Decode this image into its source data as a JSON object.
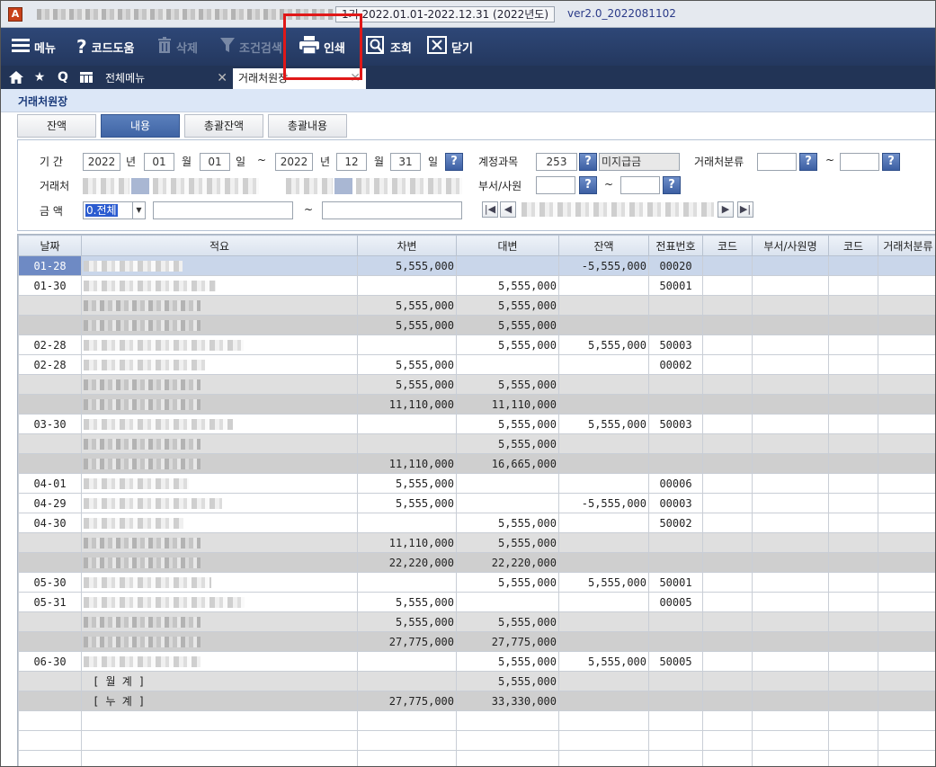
{
  "title_bar": {
    "period": "1기 2022.01.01-2022.12.31 (2022년도)",
    "version": "ver2.0_2022081102"
  },
  "toolbar": {
    "menu": "메뉴",
    "code_help": "코드도움",
    "delete": "삭제",
    "condition_search": "조건검색",
    "print": "인쇄",
    "query": "조회",
    "close": "닫기"
  },
  "tabs": {
    "all_menu": "전체메뉴",
    "ledger": "거래처원장"
  },
  "screen_title": "거래처원장",
  "view_tabs": [
    "잔액",
    "내용",
    "총괄잔액",
    "총괄내용"
  ],
  "filters": {
    "period_label": "기 간",
    "from_year": "2022",
    "from_month": "01",
    "from_day": "01",
    "to_year": "2022",
    "to_month": "12",
    "to_day": "31",
    "year_unit": "년",
    "month_unit": "월",
    "day_unit": "일",
    "tilde": "~",
    "account_label": "계정과목",
    "account_code": "253",
    "account_name": "미지급금",
    "partner_type_label": "거래처분류",
    "partner_label": "거래처",
    "dept_label": "부서/사원",
    "amount_label": "금 액",
    "amount_value": "0.전체",
    "help": "?"
  },
  "grid": {
    "columns": [
      "날짜",
      "적요",
      "차변",
      "대변",
      "잔액",
      "전표번호",
      "코드",
      "부서/사원명",
      "코드",
      "거래처분류"
    ],
    "rows": [
      {
        "date": "01-28",
        "memo": "",
        "debit": "5,555,000",
        "credit": "",
        "balance": "-5,555,000",
        "voucher": "00020",
        "tone": "sel"
      },
      {
        "date": "01-30",
        "memo": "",
        "debit": "",
        "credit": "5,555,000",
        "balance": "",
        "voucher": "50001",
        "tone": "t1"
      },
      {
        "date": "",
        "memo": "",
        "debit": "5,555,000",
        "credit": "5,555,000",
        "balance": "",
        "voucher": "",
        "tone": "t2"
      },
      {
        "date": "",
        "memo": "",
        "debit": "5,555,000",
        "credit": "5,555,000",
        "balance": "",
        "voucher": "",
        "tone": "t3"
      },
      {
        "date": "02-28",
        "memo": "",
        "debit": "",
        "credit": "5,555,000",
        "balance": "5,555,000",
        "voucher": "50003",
        "tone": "t1"
      },
      {
        "date": "02-28",
        "memo": "",
        "debit": "5,555,000",
        "credit": "",
        "balance": "",
        "voucher": "00002",
        "tone": "t1"
      },
      {
        "date": "",
        "memo": "",
        "debit": "5,555,000",
        "credit": "5,555,000",
        "balance": "",
        "voucher": "",
        "tone": "t2"
      },
      {
        "date": "",
        "memo": "",
        "debit": "11,110,000",
        "credit": "11,110,000",
        "balance": "",
        "voucher": "",
        "tone": "t3"
      },
      {
        "date": "03-30",
        "memo": "",
        "debit": "",
        "credit": "5,555,000",
        "balance": "5,555,000",
        "voucher": "50003",
        "tone": "t1"
      },
      {
        "date": "",
        "memo": "",
        "debit": "",
        "credit": "5,555,000",
        "balance": "",
        "voucher": "",
        "tone": "t2"
      },
      {
        "date": "",
        "memo": "",
        "debit": "11,110,000",
        "credit": "16,665,000",
        "balance": "",
        "voucher": "",
        "tone": "t3"
      },
      {
        "date": "04-01",
        "memo": "",
        "debit": "5,555,000",
        "credit": "",
        "balance": "",
        "voucher": "00006",
        "tone": "t1"
      },
      {
        "date": "04-29",
        "memo": "",
        "debit": "5,555,000",
        "credit": "",
        "balance": "-5,555,000",
        "voucher": "00003",
        "tone": "t1"
      },
      {
        "date": "04-30",
        "memo": "",
        "debit": "",
        "credit": "5,555,000",
        "balance": "",
        "voucher": "50002",
        "tone": "t1"
      },
      {
        "date": "",
        "memo": "",
        "debit": "11,110,000",
        "credit": "5,555,000",
        "balance": "",
        "voucher": "",
        "tone": "t2"
      },
      {
        "date": "",
        "memo": "",
        "debit": "22,220,000",
        "credit": "22,220,000",
        "balance": "",
        "voucher": "",
        "tone": "t3"
      },
      {
        "date": "05-30",
        "memo": "",
        "debit": "",
        "credit": "5,555,000",
        "balance": "5,555,000",
        "voucher": "50001",
        "tone": "t1"
      },
      {
        "date": "05-31",
        "memo": "",
        "debit": "5,555,000",
        "credit": "",
        "balance": "",
        "voucher": "00005",
        "tone": "t1"
      },
      {
        "date": "",
        "memo": "",
        "debit": "5,555,000",
        "credit": "5,555,000",
        "balance": "",
        "voucher": "",
        "tone": "t2"
      },
      {
        "date": "",
        "memo": "",
        "debit": "27,775,000",
        "credit": "27,775,000",
        "balance": "",
        "voucher": "",
        "tone": "t3"
      },
      {
        "date": "06-30",
        "memo": "",
        "debit": "",
        "credit": "5,555,000",
        "balance": "5,555,000",
        "voucher": "50005",
        "tone": "t1"
      },
      {
        "date": "",
        "memo": "[ 월          계 ]",
        "debit": "",
        "credit": "5,555,000",
        "balance": "",
        "voucher": "",
        "tone": "t2"
      },
      {
        "date": "",
        "memo": "[ 누          계 ]",
        "debit": "27,775,000",
        "credit": "33,330,000",
        "balance": "",
        "voucher": "",
        "tone": "t3"
      },
      {
        "date": "",
        "memo": "",
        "debit": "",
        "credit": "",
        "balance": "",
        "voucher": "",
        "tone": "t1"
      },
      {
        "date": "",
        "memo": "",
        "debit": "",
        "credit": "",
        "balance": "",
        "voucher": "",
        "tone": "t1"
      },
      {
        "date": "",
        "memo": "",
        "debit": "",
        "credit": "",
        "balance": "",
        "voucher": "",
        "tone": "t1"
      }
    ]
  }
}
